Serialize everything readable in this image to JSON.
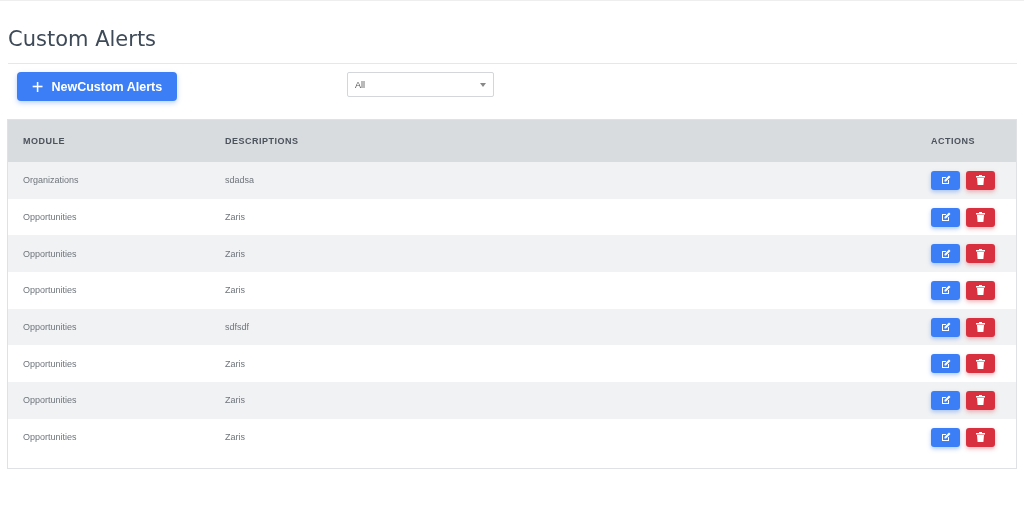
{
  "page_title": "Custom Alerts",
  "new_button": {
    "icon": "+",
    "label": "NewCustom Alerts"
  },
  "filter_select": {
    "value": "All"
  },
  "table": {
    "columns": [
      "MODULE",
      "DESCRIPTIONS",
      "ACTIONS"
    ],
    "rows": [
      {
        "module": "Organizations",
        "description": "sdadsa"
      },
      {
        "module": "Opportunities",
        "description": "Zaris"
      },
      {
        "module": "Opportunities",
        "description": "Zaris"
      },
      {
        "module": "Opportunities",
        "description": "Zaris"
      },
      {
        "module": "Opportunities",
        "description": "sdfsdf"
      },
      {
        "module": "Opportunities",
        "description": "Zaris"
      },
      {
        "module": "Opportunities",
        "description": "Zaris"
      },
      {
        "module": "Opportunities",
        "description": "Zaris"
      }
    ]
  }
}
